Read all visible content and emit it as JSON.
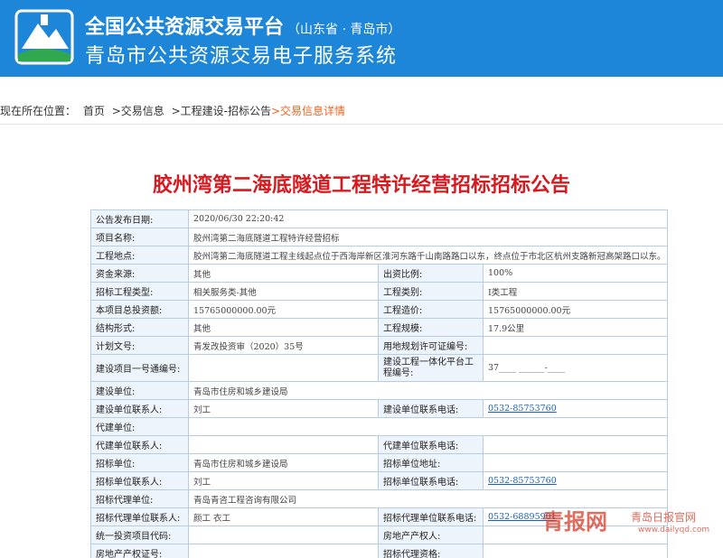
{
  "header": {
    "title_main": "全国公共资源交易平台",
    "title_sub": "（山东省 · 青岛市）",
    "title_secondary": "青岛市公共资源交易电子服务系统"
  },
  "breadcrumb": {
    "prefix": "现在所在位置：",
    "items": [
      "首页",
      ">交易信息",
      ">工程建设-招标公告",
      ">交易信息详情"
    ]
  },
  "page": {
    "title": "胶州湾第二海底隧道工程特许经营招标招标公告"
  },
  "table": {
    "publish_date_label": "公告发布日期:",
    "publish_date": "2020/06/30 22:20:42",
    "project_name_label": "项目名称:",
    "project_name": "胶州湾第二海底隧道工程特许经营招标",
    "location_label": "工程地点:",
    "location": "胶州湾第二海底隧道工程主线起点位于西海岸新区淮河东路千山南路路口以东，终点位于市北区杭州支路新冠高架路口以东。",
    "fund_source_label": "资金来源:",
    "fund_source": "其他",
    "fund_ratio_label": "出资比例:",
    "fund_ratio": "100%",
    "tender_type_label": "招标工程类型:",
    "tender_type": "相关服务类-其他",
    "project_category_label": "工程类别:",
    "project_category": "Ⅰ类工程",
    "total_investment_label": "本项目总投资额:",
    "total_investment": "15765000000.00元",
    "project_cost_label": "工程造价:",
    "project_cost": "15765000000.00元",
    "structure_label": "结构形式:",
    "structure": "其他",
    "scale_label": "工程规模:",
    "scale": "17.9公里",
    "plan_doc_label": "计划文号:",
    "plan_doc": "青发改投资审（2020）35号",
    "land_permit_label": "用地规划许可证编号:",
    "land_permit": "",
    "project_code_label": "建设项目一号通编号:",
    "project_code": "",
    "platform_code_label": "建设工程一体化平台工程编号:",
    "platform_code": "37____ ______-____",
    "owner_label": "建设单位:",
    "owner": "青岛市住房和城乡建设局",
    "owner_contact_label": "建设单位联系人:",
    "owner_contact": "刘工",
    "owner_phone_label": "建设单位联系电话:",
    "owner_phone": "0532-85753760",
    "agent_builder_label": "代建单位:",
    "agent_builder": "",
    "agent_builder_contact_label": "代建单位联系人:",
    "agent_builder_contact": "",
    "agent_builder_phone_label": "代建单位联系电话:",
    "agent_builder_phone": "",
    "tenderer_label": "招标单位:",
    "tenderer": "青岛市住房和城乡建设局",
    "tenderer_address_label": "招标单位地址:",
    "tenderer_address": "",
    "tenderer_contact_label": "招标单位联系人:",
    "tenderer_contact": "刘工",
    "tenderer_phone_label": "招标单位联系电话:",
    "tenderer_phone": "0532-85753760",
    "tender_agent_label": "招标代理单位:",
    "tender_agent": "青岛青咨工程咨询有限公司",
    "tender_agent_contact_label": "招标代理单位联系人:",
    "tender_agent_contact": "颜工 衣工",
    "tender_agent_phone_label": "招标代理单位联系电话:",
    "tender_agent_phone": "0532-68895901",
    "invest_code_label": "统一投资项目代码:",
    "invest_code": "",
    "property_owner_label": "房地产产权人:",
    "property_owner": "",
    "property_cert_label": "房地产产权证号:",
    "property_cert": "",
    "agent_qualification_label": "招标代理资格:",
    "agent_qualification": ""
  },
  "watermark": {
    "brand": "青报网",
    "tagline": "青岛日报官网",
    "url": "www.dailyqd.com"
  },
  "colors": {
    "header_bg": "#1e86d9",
    "title_red": "#d71920",
    "breadcrumb_current": "#f26522",
    "table_border": "#b9cde2",
    "label_bg": "#eef4fb",
    "link_blue": "#1a5fb4"
  }
}
